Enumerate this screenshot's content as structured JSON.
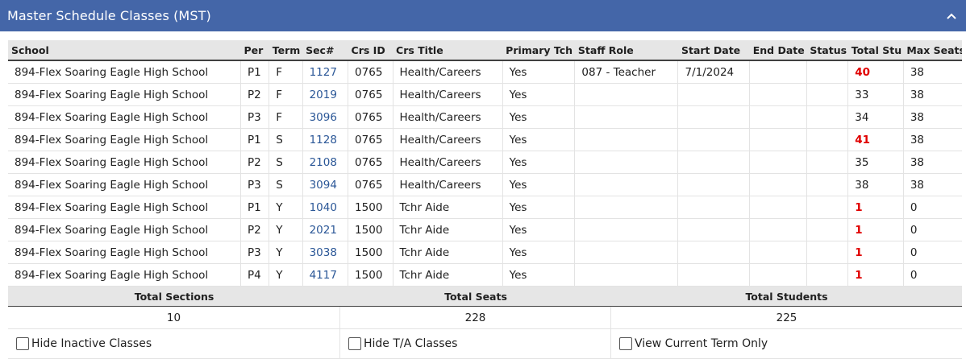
{
  "header": {
    "title": "Master Schedule Classes (MST)",
    "collapse_icon": "chevron-up-icon"
  },
  "columns": [
    "School",
    "Per",
    "Term",
    "Sec#",
    "Crs ID",
    "Crs Title",
    "Primary Tch",
    "Staff Role",
    "Start Date",
    "End Date",
    "Status",
    "Total Stu",
    "Max Seats"
  ],
  "rows": [
    {
      "school": "894-Flex Soaring Eagle High School",
      "per": "P1",
      "term": "F",
      "sec": "1127",
      "crs_id": "0765",
      "crs_title": "Health/Careers",
      "primary_tch": "Yes",
      "staff_role": "087 - Teacher",
      "start_date": "7/1/2024",
      "end_date": "",
      "status": "",
      "total_stu": "40",
      "max_seats": "38",
      "over": true
    },
    {
      "school": "894-Flex Soaring Eagle High School",
      "per": "P2",
      "term": "F",
      "sec": "2019",
      "crs_id": "0765",
      "crs_title": "Health/Careers",
      "primary_tch": "Yes",
      "staff_role": "",
      "start_date": "",
      "end_date": "",
      "status": "",
      "total_stu": "33",
      "max_seats": "38",
      "over": false
    },
    {
      "school": "894-Flex Soaring Eagle High School",
      "per": "P3",
      "term": "F",
      "sec": "3096",
      "crs_id": "0765",
      "crs_title": "Health/Careers",
      "primary_tch": "Yes",
      "staff_role": "",
      "start_date": "",
      "end_date": "",
      "status": "",
      "total_stu": "34",
      "max_seats": "38",
      "over": false
    },
    {
      "school": "894-Flex Soaring Eagle High School",
      "per": "P1",
      "term": "S",
      "sec": "1128",
      "crs_id": "0765",
      "crs_title": "Health/Careers",
      "primary_tch": "Yes",
      "staff_role": "",
      "start_date": "",
      "end_date": "",
      "status": "",
      "total_stu": "41",
      "max_seats": "38",
      "over": true
    },
    {
      "school": "894-Flex Soaring Eagle High School",
      "per": "P2",
      "term": "S",
      "sec": "2108",
      "crs_id": "0765",
      "crs_title": "Health/Careers",
      "primary_tch": "Yes",
      "staff_role": "",
      "start_date": "",
      "end_date": "",
      "status": "",
      "total_stu": "35",
      "max_seats": "38",
      "over": false
    },
    {
      "school": "894-Flex Soaring Eagle High School",
      "per": "P3",
      "term": "S",
      "sec": "3094",
      "crs_id": "0765",
      "crs_title": "Health/Careers",
      "primary_tch": "Yes",
      "staff_role": "",
      "start_date": "",
      "end_date": "",
      "status": "",
      "total_stu": "38",
      "max_seats": "38",
      "over": false
    },
    {
      "school": "894-Flex Soaring Eagle High School",
      "per": "P1",
      "term": "Y",
      "sec": "1040",
      "crs_id": "1500",
      "crs_title": "Tchr Aide",
      "primary_tch": "Yes",
      "staff_role": "",
      "start_date": "",
      "end_date": "",
      "status": "",
      "total_stu": "1",
      "max_seats": "0",
      "over": true
    },
    {
      "school": "894-Flex Soaring Eagle High School",
      "per": "P2",
      "term": "Y",
      "sec": "2021",
      "crs_id": "1500",
      "crs_title": "Tchr Aide",
      "primary_tch": "Yes",
      "staff_role": "",
      "start_date": "",
      "end_date": "",
      "status": "",
      "total_stu": "1",
      "max_seats": "0",
      "over": true
    },
    {
      "school": "894-Flex Soaring Eagle High School",
      "per": "P3",
      "term": "Y",
      "sec": "3038",
      "crs_id": "1500",
      "crs_title": "Tchr Aide",
      "primary_tch": "Yes",
      "staff_role": "",
      "start_date": "",
      "end_date": "",
      "status": "",
      "total_stu": "1",
      "max_seats": "0",
      "over": true
    },
    {
      "school": "894-Flex Soaring Eagle High School",
      "per": "P4",
      "term": "Y",
      "sec": "4117",
      "crs_id": "1500",
      "crs_title": "Tchr Aide",
      "primary_tch": "Yes",
      "staff_role": "",
      "start_date": "",
      "end_date": "",
      "status": "",
      "total_stu": "1",
      "max_seats": "0",
      "over": true
    }
  ],
  "totals": {
    "sections_label": "Total Sections",
    "sections_value": "10",
    "seats_label": "Total Seats",
    "seats_value": "228",
    "students_label": "Total Students",
    "students_value": "225"
  },
  "filters": {
    "hide_inactive": "Hide Inactive Classes",
    "hide_ta": "Hide T/A Classes",
    "current_term": "View Current Term Only"
  },
  "colors": {
    "header_bg": "#4466a8",
    "over_capacity": "#e00000",
    "link": "#2b5797"
  }
}
